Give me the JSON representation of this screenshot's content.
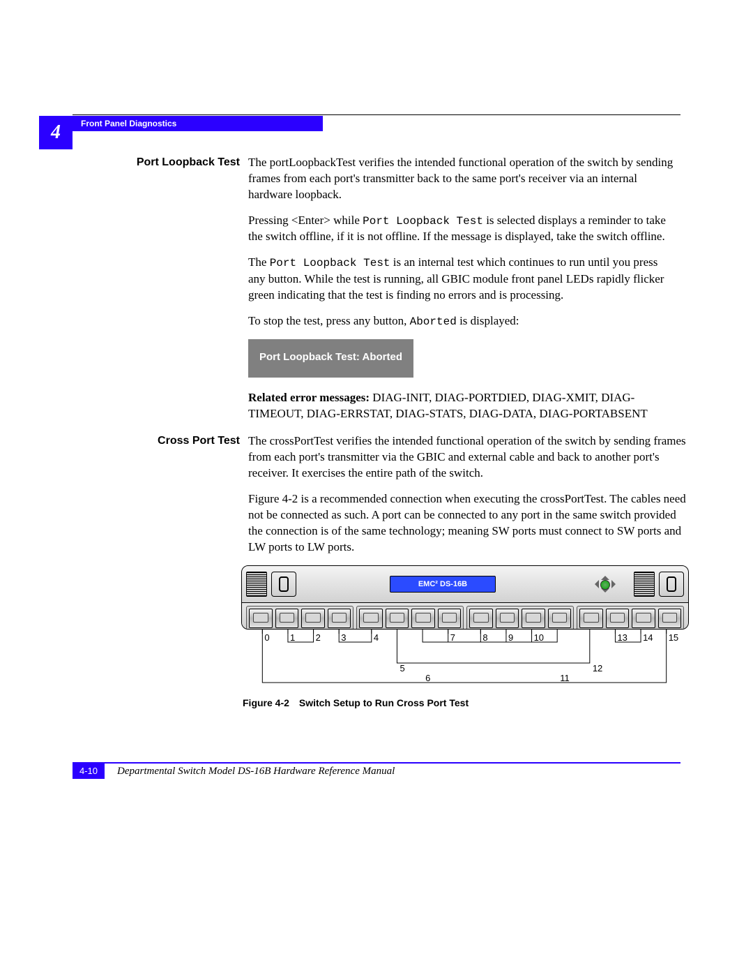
{
  "chapter_number": "4",
  "breadcrumb": "Front Panel Diagnostics",
  "sections": {
    "port_loopback": {
      "heading": "Port Loopback Test",
      "p1": "The portLoopbackTest verifies the intended functional operation of the switch by sending frames from each port's transmitter back to the same port's receiver via an internal hardware loopback.",
      "p2a": "Pressing <Enter> while ",
      "p2_code": "Port Loopback Test",
      "p2b": " is selected displays a reminder to take the switch offline, if it is not offline. If the message is displayed, take the switch offline.",
      "p3a": "The ",
      "p3_code": "Port Loopback Test",
      "p3b": " is an internal test which continues to run until you press any button. While the test is running, all GBIC module front panel LEDs rapidly flicker green indicating that the test is finding no errors and is processing.",
      "p4a": "To stop the test, press any button, ",
      "p4_code": "Aborted",
      "p4b": " is displayed:",
      "aborted_label": "Port Loopback Test: Aborted",
      "related_lead": "Related error messages:",
      "related_msgs": " DIAG-INIT, DIAG-PORTDIED, DIAG-XMIT, DIAG-TIMEOUT, DIAG-ERRSTAT, DIAG-STATS, DIAG-DATA, DIAG-PORTABSENT"
    },
    "cross_port": {
      "heading": "Cross Port Test",
      "p1": "The crossPortTest verifies the intended functional operation of the switch by sending frames from each port's transmitter via the GBIC and external cable and back to another port's receiver. It exercises the entire path of the switch.",
      "p2": "Figure 4-2 is a recommended connection when executing the crossPortTest. The cables need not be connected as such. A port can be connected to any port in the same switch provided the connection is of the same technology; meaning SW ports must connect to SW ports and LW ports to LW ports."
    }
  },
  "figure": {
    "device_badge_text": "EMC² DS-16B",
    "port_labels": [
      "0",
      "1",
      "2",
      "3",
      "4",
      "5",
      "6",
      "7",
      "8",
      "9",
      "10",
      "11",
      "12",
      "13",
      "14",
      "15"
    ],
    "cable_pairs": [
      [
        0,
        15
      ],
      [
        1,
        2
      ],
      [
        3,
        4
      ],
      [
        5,
        12
      ],
      [
        6,
        11
      ],
      [
        7,
        8
      ],
      [
        9,
        10
      ],
      [
        13,
        14
      ]
    ],
    "caption_lead": "Figure 4-2",
    "caption_text": "Switch Setup to Run Cross Port Test"
  },
  "footer": {
    "page_number": "4-10",
    "doc_title": "Departmental Switch Model DS-16B Hardware Reference Manual"
  }
}
